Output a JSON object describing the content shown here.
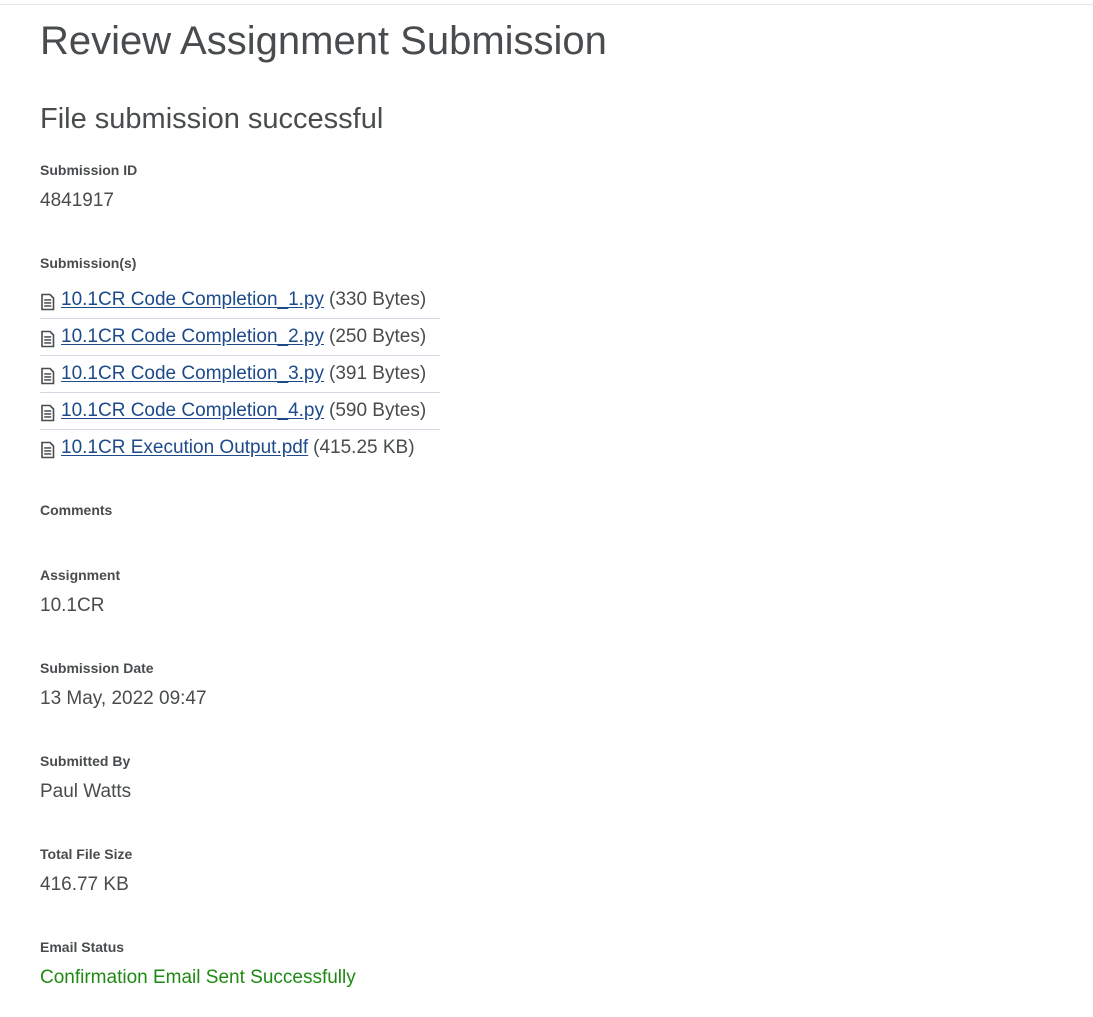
{
  "page": {
    "title": "Review Assignment Submission",
    "status_heading": "File submission successful"
  },
  "submission_id": {
    "label": "Submission ID",
    "value": "4841917"
  },
  "submissions": {
    "label": "Submission(s)",
    "icon": "file-document-icon",
    "files": [
      {
        "name": "10.1CR Code Completion_1.py",
        "size": "(330 Bytes)"
      },
      {
        "name": "10.1CR Code Completion_2.py",
        "size": "(250 Bytes)"
      },
      {
        "name": "10.1CR Code Completion_3.py",
        "size": "(391 Bytes)"
      },
      {
        "name": "10.1CR Code Completion_4.py",
        "size": "(590 Bytes)"
      },
      {
        "name": "10.1CR Execution Output.pdf",
        "size": "(415.25 KB)"
      }
    ]
  },
  "comments": {
    "label": "Comments",
    "value": ""
  },
  "assignment": {
    "label": "Assignment",
    "value": "10.1CR"
  },
  "submission_date": {
    "label": "Submission Date",
    "value": "13 May, 2022 09:47"
  },
  "submitted_by": {
    "label": "Submitted By",
    "value": "Paul Watts"
  },
  "total_file_size": {
    "label": "Total File Size",
    "value": "416.77 KB"
  },
  "email_status": {
    "label": "Email Status",
    "value": "Confirmation Email Sent Successfully",
    "color": "#1e8a13"
  },
  "colors": {
    "text": "#494c4e",
    "link": "#1c4a8b",
    "success": "#1e8a13",
    "divider": "#d3d9e3"
  }
}
